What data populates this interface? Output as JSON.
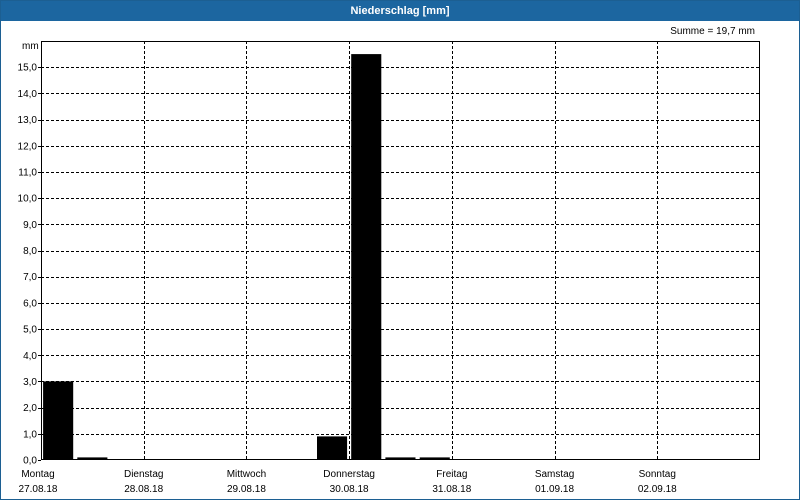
{
  "chart_data": {
    "type": "bar",
    "title": "Niederschlag [mm]",
    "summary": "Summe = 19,7 mm",
    "ylabel": "mm",
    "ylim": [
      0,
      16
    ],
    "ytick_values": [
      0,
      1,
      2,
      3,
      4,
      5,
      6,
      7,
      8,
      9,
      10,
      11,
      12,
      13,
      14,
      15
    ],
    "ytick_labels": [
      "0,0",
      "1,0",
      "2,0",
      "3,0",
      "4,0",
      "5,0",
      "6,0",
      "7,0",
      "8,0",
      "9,0",
      "10,0",
      "11,0",
      "12,0",
      "13,0",
      "14,0",
      "15,0"
    ],
    "xlim": [
      0,
      7
    ],
    "days": [
      {
        "weekday": "Montag",
        "date": "27.08.18"
      },
      {
        "weekday": "Dienstag",
        "date": "28.08.18"
      },
      {
        "weekday": "Mittwoch",
        "date": "29.08.18"
      },
      {
        "weekday": "Donnerstag",
        "date": "30.08.18"
      },
      {
        "weekday": "Freitag",
        "date": "31.08.18"
      },
      {
        "weekday": "Samstag",
        "date": "01.09.18"
      },
      {
        "weekday": "Sonntag",
        "date": "02.09.18"
      }
    ],
    "interval_hours": 8,
    "values": [
      3.0,
      0.1,
      0,
      0,
      0,
      0,
      0,
      0,
      0.9,
      15.5,
      0.1,
      0.1,
      0,
      0,
      0,
      0,
      0,
      0,
      0,
      0,
      0
    ],
    "grid": true,
    "bar_color": "#000000",
    "header_color": "#1c66a0"
  }
}
